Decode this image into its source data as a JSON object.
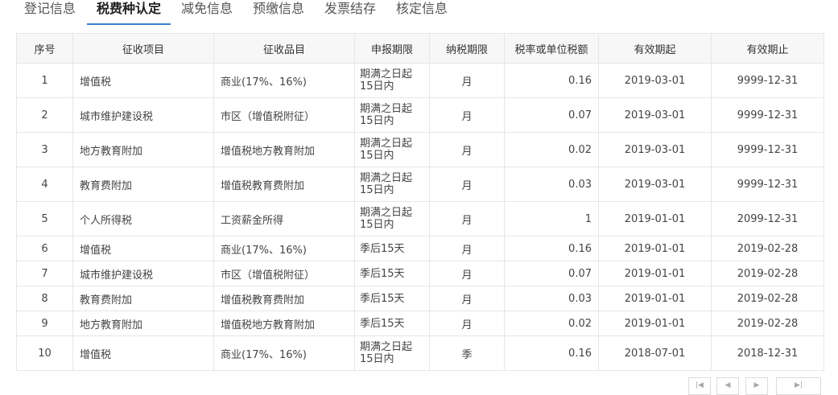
{
  "tabs": [
    {
      "label": "登记信息"
    },
    {
      "label": "税费种认定",
      "active": true
    },
    {
      "label": "减免信息"
    },
    {
      "label": "预缴信息"
    },
    {
      "label": "发票结存"
    },
    {
      "label": "核定信息"
    }
  ],
  "colors": {
    "accent": "#3a7fcf",
    "header_bg": "#f7f7f7",
    "border": "#e6e6e6"
  },
  "table": {
    "headers": [
      "序号",
      "征收项目",
      "征收品目",
      "申报期限",
      "纳税期限",
      "税率或单位税额",
      "有效期起",
      "有效期止"
    ],
    "rows": [
      {
        "no": "1",
        "item": "增值税",
        "subitem": "商业(17%、16%)",
        "period": "期满之日起15日内",
        "term": "月",
        "rate": "0.16",
        "start": "2019-03-01",
        "end": "9999-12-31"
      },
      {
        "no": "2",
        "item": "城市维护建设税",
        "subitem": "市区（增值税附征）",
        "period": "期满之日起15日内",
        "term": "月",
        "rate": "0.07",
        "start": "2019-03-01",
        "end": "9999-12-31"
      },
      {
        "no": "3",
        "item": "地方教育附加",
        "subitem": "增值税地方教育附加",
        "period": "期满之日起15日内",
        "term": "月",
        "rate": "0.02",
        "start": "2019-03-01",
        "end": "9999-12-31"
      },
      {
        "no": "4",
        "item": "教育费附加",
        "subitem": "增值税教育费附加",
        "period": "期满之日起15日内",
        "term": "月",
        "rate": "0.03",
        "start": "2019-03-01",
        "end": "9999-12-31"
      },
      {
        "no": "5",
        "item": "个人所得税",
        "subitem": "工资薪金所得",
        "period": "期满之日起15日内",
        "term": "月",
        "rate": "1",
        "start": "2019-01-01",
        "end": "2099-12-31"
      },
      {
        "no": "6",
        "item": "增值税",
        "subitem": "商业(17%、16%)",
        "period": "季后15天",
        "term": "月",
        "rate": "0.16",
        "start": "2019-01-01",
        "end": "2019-02-28"
      },
      {
        "no": "7",
        "item": "城市维护建设税",
        "subitem": "市区（增值税附征）",
        "period": "季后15天",
        "term": "月",
        "rate": "0.07",
        "start": "2019-01-01",
        "end": "2019-02-28"
      },
      {
        "no": "8",
        "item": "教育费附加",
        "subitem": "增值税教育费附加",
        "period": "季后15天",
        "term": "月",
        "rate": "0.03",
        "start": "2019-01-01",
        "end": "2019-02-28"
      },
      {
        "no": "9",
        "item": "地方教育附加",
        "subitem": "增值税地方教育附加",
        "period": "季后15天",
        "term": "月",
        "rate": "0.02",
        "start": "2019-01-01",
        "end": "2019-02-28"
      },
      {
        "no": "10",
        "item": "增值税",
        "subitem": "商业(17%、16%)",
        "period": "期满之日起15日内",
        "term": "季",
        "rate": "0.16",
        "start": "2018-07-01",
        "end": "2018-12-31"
      }
    ]
  },
  "pagination": {
    "buttons": [
      "first-page-icon",
      "prev-page-icon",
      "next-page-icon",
      "last-page-icon"
    ]
  }
}
